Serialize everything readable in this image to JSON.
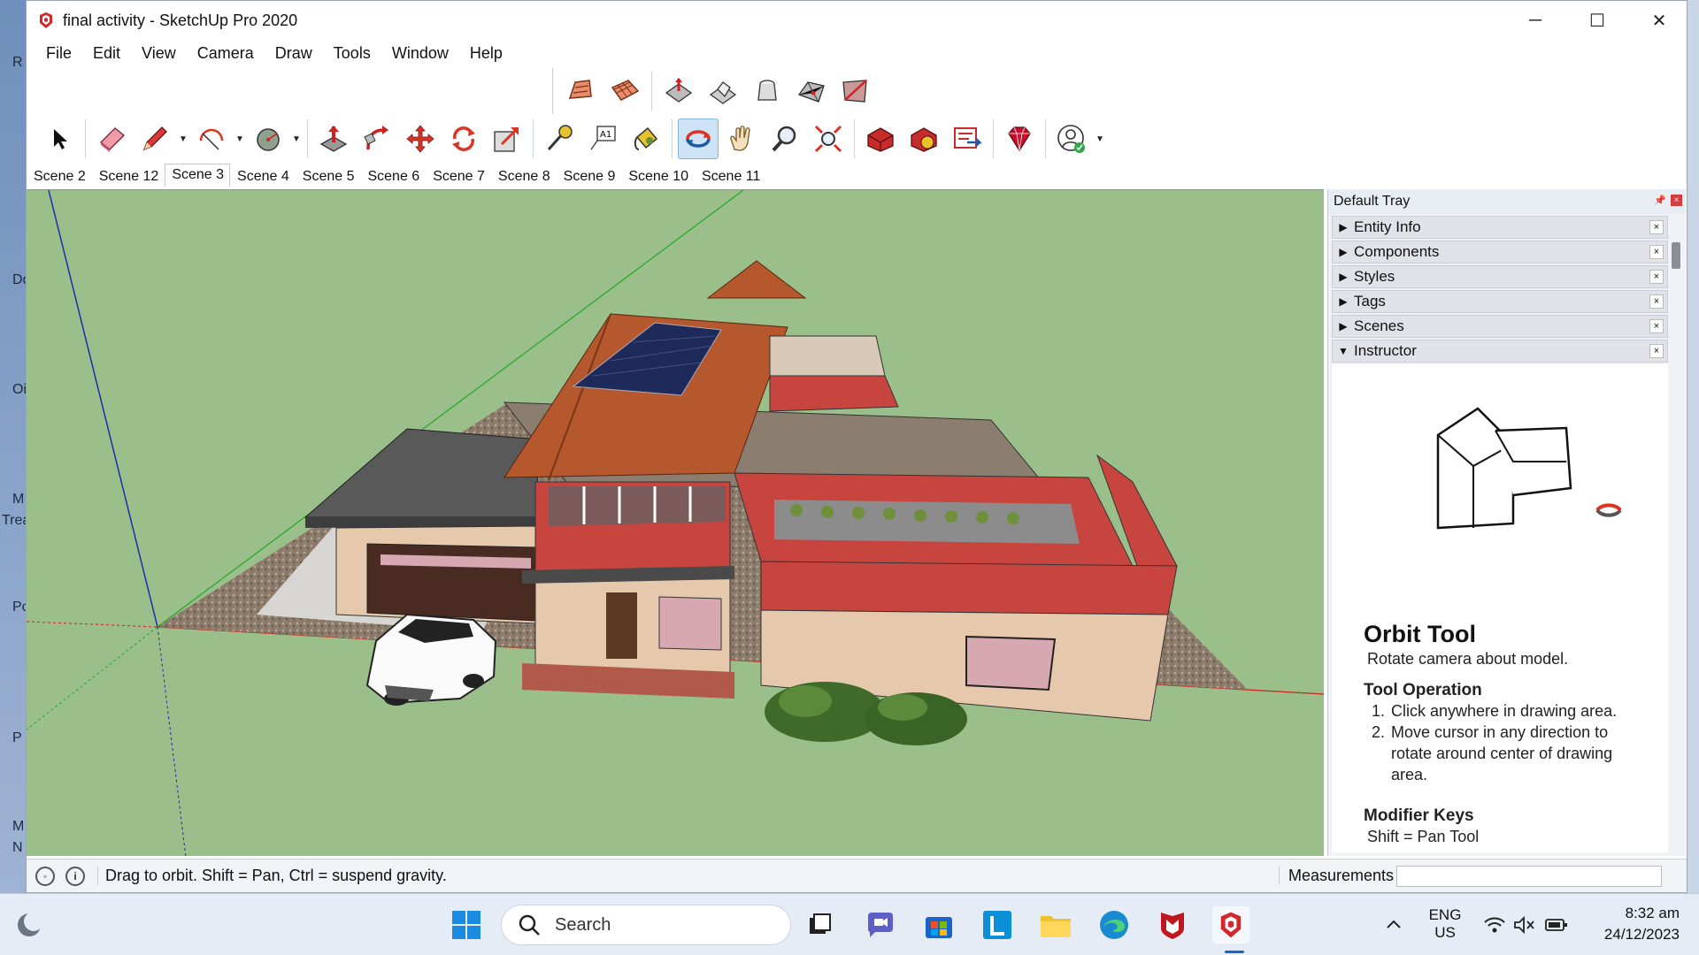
{
  "desktop_strip": [
    "R",
    "Do",
    "Oi",
    "M",
    "Trea",
    "Pc",
    "P",
    "M",
    "N"
  ],
  "window": {
    "title": "final activity - SketchUp Pro 2020"
  },
  "window_controls": {
    "minimize": "─",
    "maximize": "☐",
    "close": "✕"
  },
  "menu": [
    "File",
    "Edit",
    "View",
    "Camera",
    "Draw",
    "Tools",
    "Window",
    "Help"
  ],
  "toolbar_top": [
    "sandbox-from-contours",
    "sandbox-from-scratch",
    "smoove",
    "stamp",
    "drape",
    "add-detail",
    "flip-edge"
  ],
  "toolbar_main": [
    "select",
    "eraser",
    "line",
    "arc",
    "circle",
    "push-pull",
    "follow-me",
    "move",
    "rotate",
    "scale",
    "tape-measure",
    "text",
    "paint-bucket",
    "orbit",
    "pan",
    "zoom",
    "zoom-extents",
    "3d-warehouse",
    "extension-warehouse",
    "layout",
    "extension-manager",
    "account"
  ],
  "scenes": {
    "tabs": [
      "Scene 2",
      "Scene 12",
      "Scene 3",
      "Scene 4",
      "Scene 5",
      "Scene 6",
      "Scene 7",
      "Scene 8",
      "Scene 9",
      "Scene 10",
      "Scene 11"
    ],
    "selected_index": 2
  },
  "colors": {
    "sky": "#9bbf8a",
    "roof": "#b5582e",
    "wall": "#e6c8ad",
    "siding": "#c8453f",
    "accent": "#1a66c8"
  },
  "tray": {
    "title": "Default Tray",
    "panels": [
      {
        "label": "Entity Info",
        "expanded": false
      },
      {
        "label": "Components",
        "expanded": false
      },
      {
        "label": "Styles",
        "expanded": false
      },
      {
        "label": "Tags",
        "expanded": false
      },
      {
        "label": "Scenes",
        "expanded": false
      },
      {
        "label": "Instructor",
        "expanded": true
      }
    ]
  },
  "instructor": {
    "title": "Orbit Tool",
    "description": "Rotate camera about model.",
    "operation_heading": "Tool Operation",
    "steps": [
      {
        "num": "1.",
        "text": "Click anywhere in drawing area."
      },
      {
        "num": "2.",
        "text": "Move cursor in any direction to rotate around center of drawing area."
      }
    ],
    "modifier_heading": "Modifier Keys",
    "modifier_line": "Shift = Pan Tool"
  },
  "status": {
    "hint": "Drag to orbit. Shift = Pan, Ctrl = suspend gravity.",
    "measurements_label": "Measurements",
    "measurements_value": ""
  },
  "taskbar": {
    "search_placeholder": "Search",
    "language": "ENG",
    "region": "US",
    "time": "8:32 am",
    "date": "24/12/2023"
  }
}
